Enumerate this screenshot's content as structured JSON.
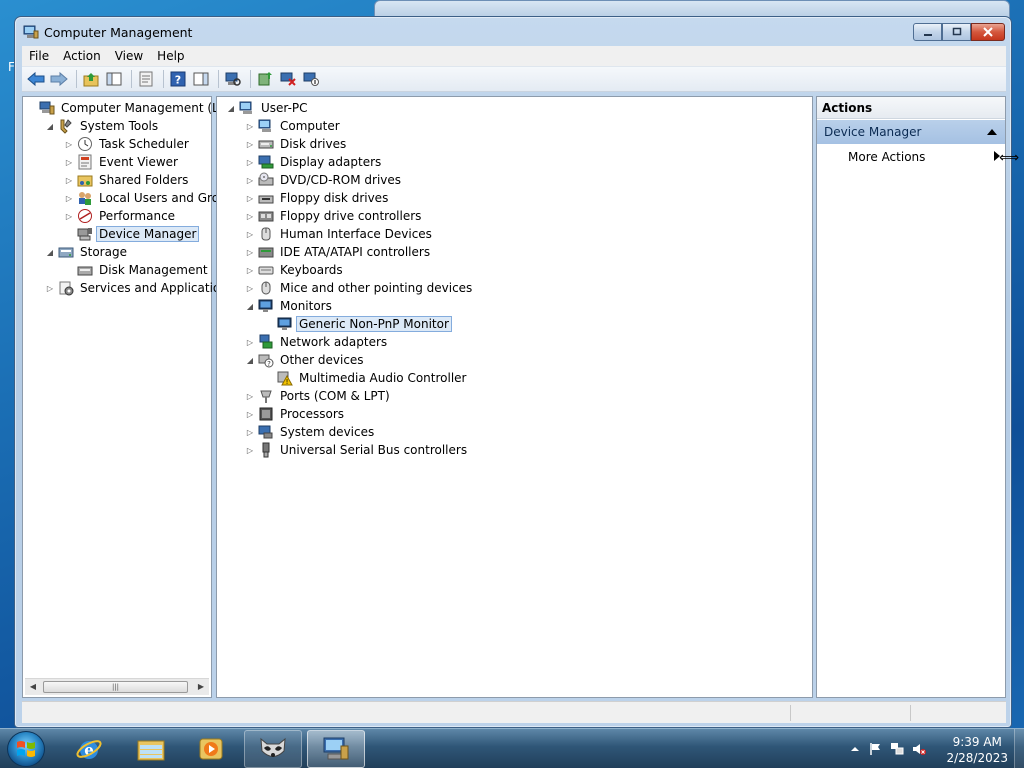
{
  "window": {
    "title": "Computer Management",
    "icon": "computer-management-icon"
  },
  "menu": [
    "File",
    "Action",
    "View",
    "Help"
  ],
  "left_tree": [
    {
      "label": "Computer Management (Local",
      "icon": "computer-management-icon",
      "level": 0,
      "expander": ""
    },
    {
      "label": "System Tools",
      "icon": "system-tools-icon",
      "level": 1,
      "expander": "expanded"
    },
    {
      "label": "Task Scheduler",
      "icon": "clock-icon",
      "level": 2,
      "expander": "collapsed"
    },
    {
      "label": "Event Viewer",
      "icon": "event-viewer-icon",
      "level": 2,
      "expander": "collapsed"
    },
    {
      "label": "Shared Folders",
      "icon": "shared-folders-icon",
      "level": 2,
      "expander": "collapsed"
    },
    {
      "label": "Local Users and Groups",
      "icon": "users-icon",
      "level": 2,
      "expander": "collapsed"
    },
    {
      "label": "Performance",
      "icon": "performance-icon",
      "level": 2,
      "expander": "collapsed"
    },
    {
      "label": "Device Manager",
      "icon": "device-manager-icon",
      "level": 2,
      "expander": "",
      "selected": true
    },
    {
      "label": "Storage",
      "icon": "storage-icon",
      "level": 1,
      "expander": "expanded"
    },
    {
      "label": "Disk Management",
      "icon": "disk-management-icon",
      "level": 2,
      "expander": ""
    },
    {
      "label": "Services and Applications",
      "icon": "services-icon",
      "level": 1,
      "expander": "collapsed"
    }
  ],
  "device_tree": [
    {
      "label": "User-PC",
      "icon": "computer-icon",
      "level": 0,
      "expander": "expanded"
    },
    {
      "label": "Computer",
      "icon": "computer-icon",
      "level": 1,
      "expander": "collapsed"
    },
    {
      "label": "Disk drives",
      "icon": "disk-drive-icon",
      "level": 1,
      "expander": "collapsed"
    },
    {
      "label": "Display adapters",
      "icon": "display-adapter-icon",
      "level": 1,
      "expander": "collapsed"
    },
    {
      "label": "DVD/CD-ROM drives",
      "icon": "dvd-drive-icon",
      "level": 1,
      "expander": "collapsed"
    },
    {
      "label": "Floppy disk drives",
      "icon": "floppy-drive-icon",
      "level": 1,
      "expander": "collapsed"
    },
    {
      "label": "Floppy drive controllers",
      "icon": "floppy-controller-icon",
      "level": 1,
      "expander": "collapsed"
    },
    {
      "label": "Human Interface Devices",
      "icon": "hid-icon",
      "level": 1,
      "expander": "collapsed"
    },
    {
      "label": "IDE ATA/ATAPI controllers",
      "icon": "ide-controller-icon",
      "level": 1,
      "expander": "collapsed"
    },
    {
      "label": "Keyboards",
      "icon": "keyboard-icon",
      "level": 1,
      "expander": "collapsed"
    },
    {
      "label": "Mice and other pointing devices",
      "icon": "mouse-icon",
      "level": 1,
      "expander": "collapsed"
    },
    {
      "label": "Monitors",
      "icon": "monitor-icon",
      "level": 1,
      "expander": "expanded"
    },
    {
      "label": "Generic Non-PnP Monitor",
      "icon": "monitor-icon",
      "level": 2,
      "expander": "",
      "selected": true
    },
    {
      "label": "Network adapters",
      "icon": "network-adapter-icon",
      "level": 1,
      "expander": "collapsed"
    },
    {
      "label": "Other devices",
      "icon": "unknown-device-icon",
      "level": 1,
      "expander": "expanded"
    },
    {
      "label": "Multimedia Audio Controller",
      "icon": "warning-device-icon",
      "level": 2,
      "expander": ""
    },
    {
      "label": "Ports (COM & LPT)",
      "icon": "port-icon",
      "level": 1,
      "expander": "collapsed"
    },
    {
      "label": "Processors",
      "icon": "processor-icon",
      "level": 1,
      "expander": "collapsed"
    },
    {
      "label": "System devices",
      "icon": "system-devices-icon",
      "level": 1,
      "expander": "collapsed"
    },
    {
      "label": "Universal Serial Bus controllers",
      "icon": "usb-icon",
      "level": 1,
      "expander": "collapsed"
    }
  ],
  "actions": {
    "header": "Actions",
    "section": "Device Manager",
    "item": "More Actions"
  },
  "taskbar": {
    "apps": [
      "internet-explorer-icon",
      "windows-explorer-icon",
      "media-player-icon",
      "raccoon-app-icon",
      "computer-management-icon"
    ],
    "time": "9:39 AM",
    "date": "2/28/2023"
  },
  "background_stub": "F"
}
